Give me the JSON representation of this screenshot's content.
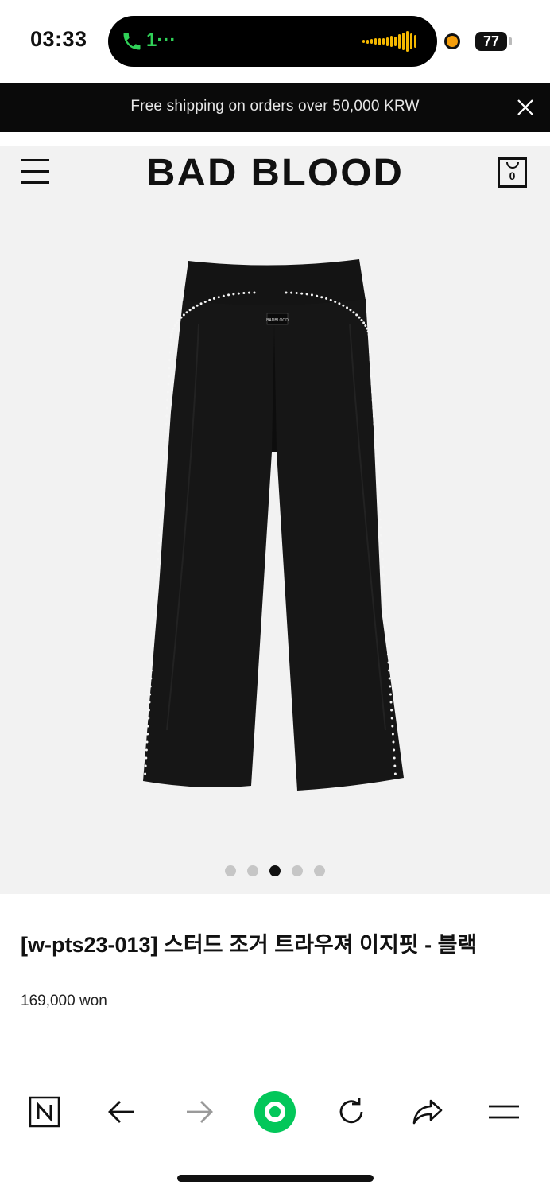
{
  "status_bar": {
    "time": "03:33",
    "call_label": "1···",
    "battery": "77",
    "colors": {
      "call": "#30d158",
      "waveform": "#f5b800",
      "privacy_dot": "#f59e0b"
    }
  },
  "promo": {
    "text": "Free shipping on orders over 50,000 KRW",
    "close_icon": "close-icon"
  },
  "header": {
    "menu_icon": "hamburger-menu-icon",
    "brand": "BAD BLOOD",
    "cart_count": "0",
    "cart_icon": "shopping-bag-icon"
  },
  "gallery": {
    "image_label_text": "BADBLOOD",
    "slide_count": 5,
    "active_index": 2
  },
  "product": {
    "title": "[w-pts23-013] 스터드 조거 트라우져 이지핏 - 블랙",
    "price": "169,000 won"
  },
  "toolbar": {
    "items": [
      "naver-n-icon",
      "back-arrow-icon",
      "forward-arrow-icon",
      "green-home-icon",
      "refresh-icon",
      "share-icon",
      "menu-icon"
    ],
    "accent": "#03c75a"
  }
}
